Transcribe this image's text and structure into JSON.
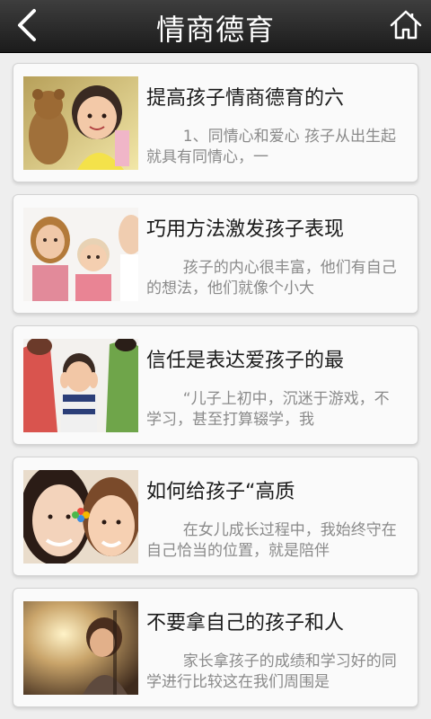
{
  "header": {
    "title": "情商德育",
    "back_icon": "chevron-left-icon",
    "home_icon": "home-icon"
  },
  "articles": [
    {
      "title": "提高孩子情商德育的六",
      "summary": "1、同情心和爱心 孩子从出生起就具有同情心，一",
      "image": "girl-with-teddy-bear"
    },
    {
      "title": "巧用方法激发孩子表现",
      "summary": "孩子的内心很丰富，他们有自己的想法，他们就像个小大",
      "image": "three-children"
    },
    {
      "title": "信任是表达爱孩子的最",
      "summary": "“儿子上初中，沉迷于游戏，不学习，甚至打算辍学，我",
      "image": "boy-between-parents"
    },
    {
      "title": "如何给孩子“高质",
      "summary": "在女儿成长过程中，我始终守在自己恰当的位置，就是陪伴",
      "image": "mother-and-daughter-smiling"
    },
    {
      "title": "不要拿自己的孩子和人",
      "summary": "家长拿孩子的成绩和学习好的同学进行比较这在我们周围是",
      "image": "child-in-sunlight"
    }
  ]
}
